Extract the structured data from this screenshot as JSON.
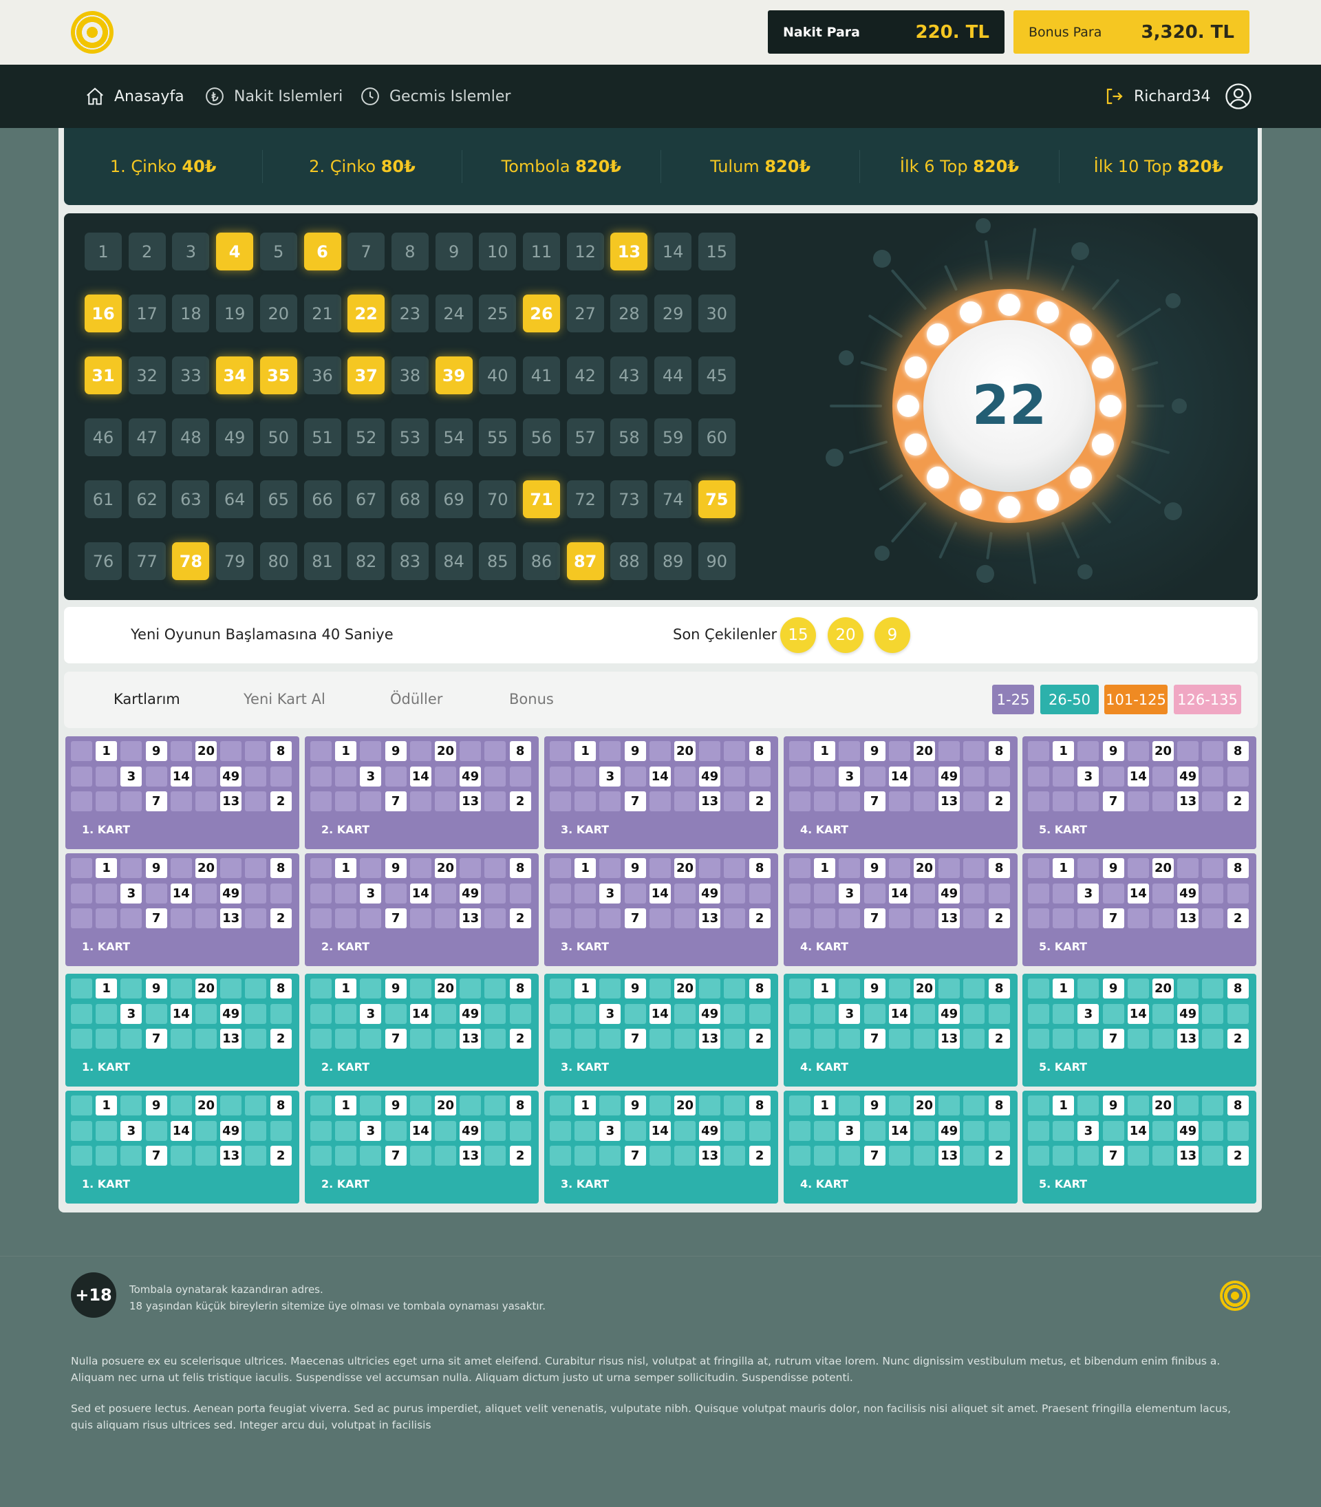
{
  "header": {
    "cash_label": "Nakit Para",
    "cash_amount": "220. TL",
    "bonus_label": "Bonus Para",
    "bonus_amount": "3,320. TL"
  },
  "nav": {
    "home": "Anasayfa",
    "cash_ops": "Nakit Islemleri",
    "history": "Gecmis Islemler",
    "username": "Richard34"
  },
  "prizes": [
    {
      "label": "1. Çinko",
      "amount": "40₺"
    },
    {
      "label": "2. Çinko",
      "amount": "80₺"
    },
    {
      "label": "Tombola",
      "amount": "820₺"
    },
    {
      "label": "Tulum",
      "amount": "820₺"
    },
    {
      "label": "İlk 6 Top",
      "amount": "820₺"
    },
    {
      "label": "İlk 10 Top",
      "amount": "820₺"
    }
  ],
  "board": {
    "drawn": [
      4,
      6,
      13,
      16,
      22,
      26,
      31,
      34,
      35,
      37,
      39,
      71,
      75,
      78,
      87
    ],
    "current_ball": "22"
  },
  "status": {
    "countdown_text": "Yeni Oyunun Başlamasına 40 Saniye",
    "last_drawn_label": "Son Çekilenler",
    "last_drawn": [
      "15",
      "20",
      "9"
    ]
  },
  "tabs": {
    "my_cards": "Kartlarım",
    "buy_card": "Yeni Kart Al",
    "rewards": "Ödüller",
    "bonus": "Bonus",
    "ranges": [
      {
        "label": "1-25",
        "color": "#8f7fb8"
      },
      {
        "label": "26-50",
        "color": "#2cb1ab"
      },
      {
        "label": "101-125",
        "color": "#ef8a22"
      },
      {
        "label": "126-135",
        "color": "#f0a7c3"
      }
    ]
  },
  "cards": {
    "rows": [
      [
        0,
        1,
        0,
        9,
        0,
        20,
        0,
        0,
        8
      ],
      [
        0,
        0,
        3,
        0,
        14,
        0,
        49,
        0,
        0
      ],
      [
        0,
        0,
        0,
        7,
        0,
        0,
        13,
        0,
        2
      ]
    ],
    "labels": [
      "1. KART",
      "2. KART",
      "3. KART",
      "4. KART",
      "5. KART"
    ],
    "row_themes": [
      "purple",
      "purple",
      "teal",
      "teal"
    ]
  },
  "footer": {
    "age_badge": "+18",
    "line1": "Tombala oynatarak kazandıran adres.",
    "line2": "18 yaşından küçük bireylerin sitemize üye olması ve tombala oynaması yasaktır.",
    "para1": "Nulla posuere ex eu scelerisque ultrices. Maecenas ultricies eget urna sit amet eleifend. Curabitur risus nisl, volutpat at fringilla at, rutrum vitae lorem. Nunc dignissim vestibulum metus, et bibendum enim finibus a. Aliquam nec urna ut felis tristique iaculis. Suspendisse vel accumsan nulla. Aliquam dictum justo ut urna semper sollicitudin. Suspendisse potenti.",
    "para2": "Sed et posuere lectus. Aenean porta feugiat viverra. Sed ac purus imperdiet, aliquet velit venenatis, vulputate nibh. Quisque volutpat mauris dolor, non facilisis nisi aliquet sit amet. Praesent fringilla elementum lacus, quis aliquam risus ultrices sed. Integer arcu dui, volutpat in facilisis"
  },
  "colors": {
    "accent": "#f5c722",
    "nav_bg": "#172524",
    "card_purple": "#8f7fb8",
    "card_teal": "#2cb1ab"
  }
}
